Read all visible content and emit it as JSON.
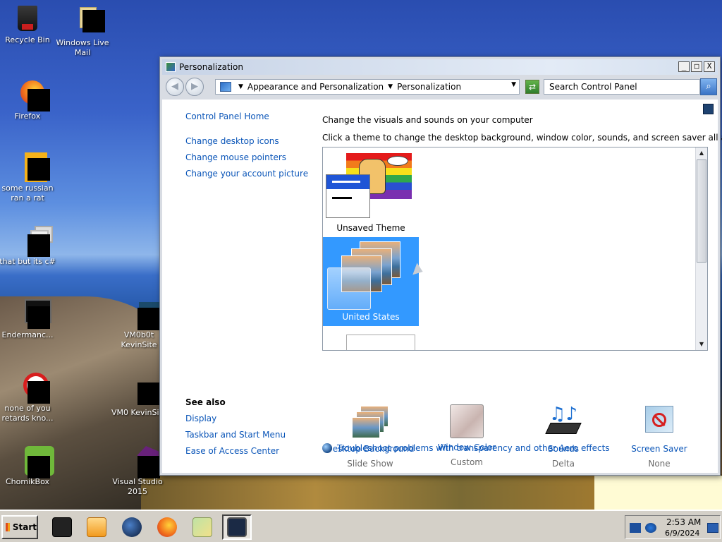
{
  "desktop": {
    "icons": [
      {
        "label": "Recycle Bin"
      },
      {
        "label": "Windows Live Mail"
      },
      {
        "label": "Firefox"
      },
      {
        "label": "some russian ran a rat"
      },
      {
        "label": "that but its c#"
      },
      {
        "label": "Endermanc..."
      },
      {
        "label": "VM0b0t KevinSite"
      },
      {
        "label": "none of you retards kno..."
      },
      {
        "label": "VM0 KevinSi..."
      },
      {
        "label": "ChomikBox"
      },
      {
        "label": "Visual Studio 2015"
      }
    ]
  },
  "window": {
    "title": "Personalization",
    "controls": {
      "minimize": "_",
      "maximize": "□",
      "close": "X"
    },
    "address": {
      "crumb1": "Appearance and Personalization",
      "crumb2": "Personalization"
    },
    "search_placeholder": "Search Control Panel"
  },
  "sidebar": {
    "home": "Control Panel Home",
    "links": [
      "Change desktop icons",
      "Change mouse pointers",
      "Change your account picture"
    ],
    "see_also_title": "See also",
    "see_also": [
      "Display",
      "Taskbar and Start Menu",
      "Ease of Access Center"
    ]
  },
  "main": {
    "heading": "Change the visuals and sounds on your computer",
    "instruction": "Click a theme to change the desktop background, window color, sounds, and screen saver all at once.",
    "themes": [
      {
        "name": "Unsaved Theme",
        "selected": false
      },
      {
        "name": "United States",
        "selected": true
      }
    ],
    "options": [
      {
        "title": "Desktop Background",
        "value": "Slide Show"
      },
      {
        "title": "Window Color",
        "value": "Custom"
      },
      {
        "title": "Sounds",
        "value": "Delta"
      },
      {
        "title": "Screen Saver",
        "value": "None"
      }
    ],
    "troubleshoot": "Troubleshoot problems with transparency and other Aero effects"
  },
  "taskbar": {
    "start_label": "Start",
    "clock_time": "2:53 AM",
    "clock_date": "6/9/2024"
  },
  "colors": {
    "link": "#0a55b8",
    "selection": "#3399ff"
  }
}
